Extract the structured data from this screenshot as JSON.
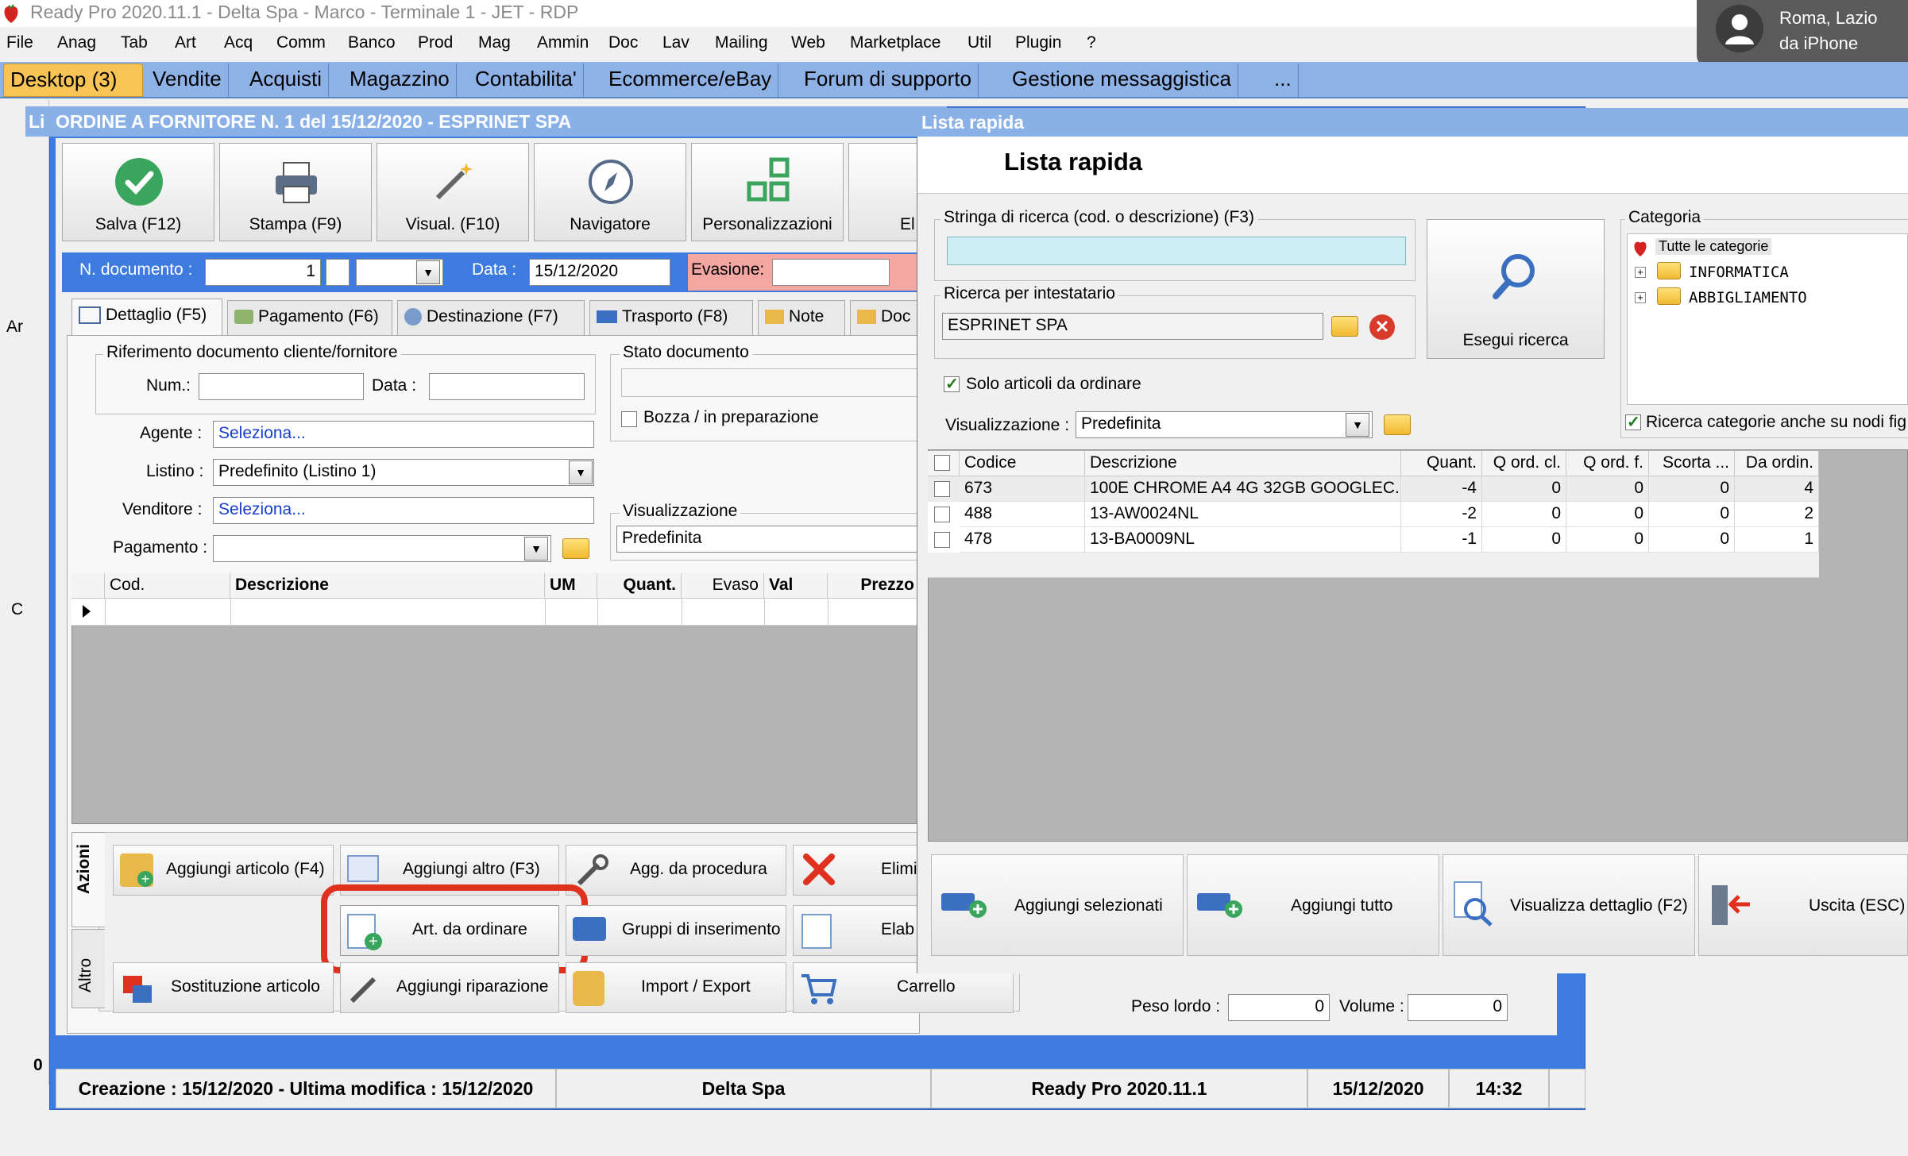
{
  "window": {
    "title": "Ready Pro 2020.11.1 - Delta Spa - Marco - Terminale 1 - JET - RDP"
  },
  "notification": {
    "line1": "Roma, Lazio",
    "line2": "da iPhone"
  },
  "menu": [
    "File",
    "Anag",
    "Tab",
    "Art",
    "Acq",
    "Comm",
    "Banco",
    "Prod",
    "Mag",
    "Ammin",
    "Doc",
    "Lav",
    "Mailing",
    "Web",
    "Marketplace",
    "Util",
    "Plugin",
    "?"
  ],
  "nav_tabs": [
    "Desktop (3)",
    "Vendite",
    "Acquisti",
    "Magazzino",
    "Contabilita'",
    "Ecommerce/eBay",
    "Forum di supporto",
    "Gestione messaggistica",
    "..."
  ],
  "order": {
    "title_prefix": "Li",
    "title": "ORDINE A FORNITORE N. 1 del 15/12/2020 - ESPRINET SPA",
    "toolbar": [
      "Salva (F12)",
      "Stampa (F9)",
      "Visual. (F10)",
      "Navigatore",
      "Personalizzazioni",
      "El"
    ],
    "n_documento_label": "N. documento :",
    "n_documento_value": "1",
    "data_label": "Data :",
    "data_value": "15/12/2020",
    "evasione_label": "Evasione:",
    "tabs": [
      "Dettaglio (F5)",
      "Pagamento (F6)",
      "Destinazione (F7)",
      "Trasporto (F8)",
      "Note",
      "Doc"
    ],
    "rif_group": "Riferimento documento cliente/fornitore",
    "num_label": "Num.:",
    "data2_label": "Data :",
    "stato_group": "Stato documento",
    "bozza_label": "Bozza / in preparazione",
    "agente_label": "Agente :",
    "agente_value": "Seleziona...",
    "listino_label": "Listino :",
    "listino_value": "Predefinito (Listino 1)",
    "venditore_label": "Venditore :",
    "venditore_value": "Seleziona...",
    "pagamento_label": "Pagamento :",
    "visual_group": "Visualizzazione",
    "visual_value": "Predefinita",
    "grid_headers": [
      "Cod.",
      "Descrizione",
      "UM",
      "Quant.",
      "Evaso",
      "Val",
      "Prezzo"
    ],
    "side_tabs": [
      "Azioni",
      "Altro"
    ],
    "actions": [
      "Aggiungi articolo (F4)",
      "Aggiungi altro (F3)",
      "Agg. da procedura",
      "Elimi",
      "Art. da ordinare",
      "Gruppi di inserimento",
      "Elab",
      "Sostituzione articolo",
      "Aggiungi riparazione",
      "Import / Export",
      "Carrello"
    ],
    "peso_label": "Peso lordo :",
    "peso_value": "0",
    "volume_label": "Volume :",
    "volume_value": "0"
  },
  "side_labels": [
    "Ar",
    "C",
    "0"
  ],
  "statusbar": [
    "Creazione : 15/12/2020 - Ultima modifica : 15/12/2020",
    "Delta Spa",
    "Ready Pro 2020.11.1",
    "15/12/2020",
    "14:32"
  ],
  "lista": {
    "window_title": "Lista rapida",
    "heading": "Lista rapida",
    "search_group": "Stringa di ricerca (cod. o descrizione) (F3)",
    "search_value": "",
    "intest_group": "Ricerca per intestatario",
    "intest_value": "ESPRINET SPA",
    "esegui": "Esegui ricerca",
    "categoria_group": "Categoria",
    "categories": [
      "Tutte le categorie",
      "INFORMATICA",
      "ABBIGLIAMENTO"
    ],
    "solo_label": "Solo articoli da ordinare",
    "ricerca_cat_label": "Ricerca categorie anche su nodi fig",
    "visual_label": "Visualizzazione :",
    "visual_value": "Predefinita",
    "headers": [
      "Codice",
      "Descrizione",
      "Quant.",
      "Q ord. cl.",
      "Q ord. f.",
      "Scorta ...",
      "Da ordin."
    ],
    "rows": [
      [
        "673",
        "100E CHROME A4 4G 32GB GOOGLEC...",
        "-4",
        "0",
        "0",
        "0",
        "4"
      ],
      [
        "488",
        "13-AW0024NL",
        "-2",
        "0",
        "0",
        "0",
        "2"
      ],
      [
        "478",
        "13-BA0009NL",
        "-1",
        "0",
        "0",
        "0",
        "1"
      ]
    ],
    "buttons": [
      "Aggiungi selezionati",
      "Aggiungi tutto",
      "Visualizza dettaglio (F2)",
      "Uscita (ESC)"
    ]
  },
  "colors": {
    "accent_blue": "#3d7be0",
    "highlight_red": "#e0301e",
    "search_cyan": "#cdeff3",
    "nav_active": "#f8c455"
  }
}
